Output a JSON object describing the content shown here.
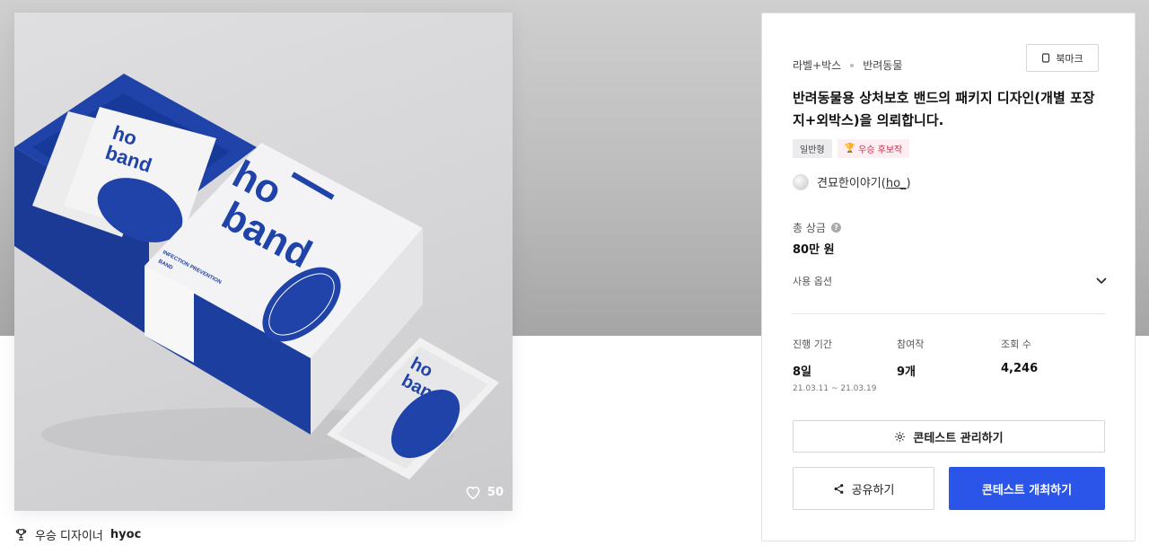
{
  "artwork": {
    "box_brand": "ho\nband",
    "like_count": "50"
  },
  "caption": {
    "prefix": "우승 디자이너",
    "designer": "hyoc"
  },
  "panel": {
    "breadcrumbs": [
      "라벨+박스",
      "반려동물"
    ],
    "bookmark_label": "북마크",
    "title": "반려동물용 상처보호 밴드의 패키지 디자인(개별 포장지+외박스)을 의뢰합니다.",
    "tags": {
      "type": "일반형",
      "award": "우승 후보작"
    },
    "author": {
      "name": "견묘한이야기",
      "handle": "ho_"
    },
    "prize": {
      "label": "총 상금",
      "value": "80만 원"
    },
    "options_label": "사용 옵션",
    "stats": {
      "period": {
        "label": "진행 기간",
        "value": "8일",
        "range": "21.03.11 ~ 21.03.19"
      },
      "entries": {
        "label": "참여작",
        "value": "9개"
      },
      "views": {
        "label": "조회 수",
        "value": "4,246"
      }
    },
    "buttons": {
      "manage": "콘테스트 관리하기",
      "share": "공유하기",
      "host": "콘테스트 개최하기"
    }
  },
  "colors": {
    "accent": "#2b55e8",
    "brand_blue": "#1f43a8",
    "award_pink": "#c2344f"
  }
}
